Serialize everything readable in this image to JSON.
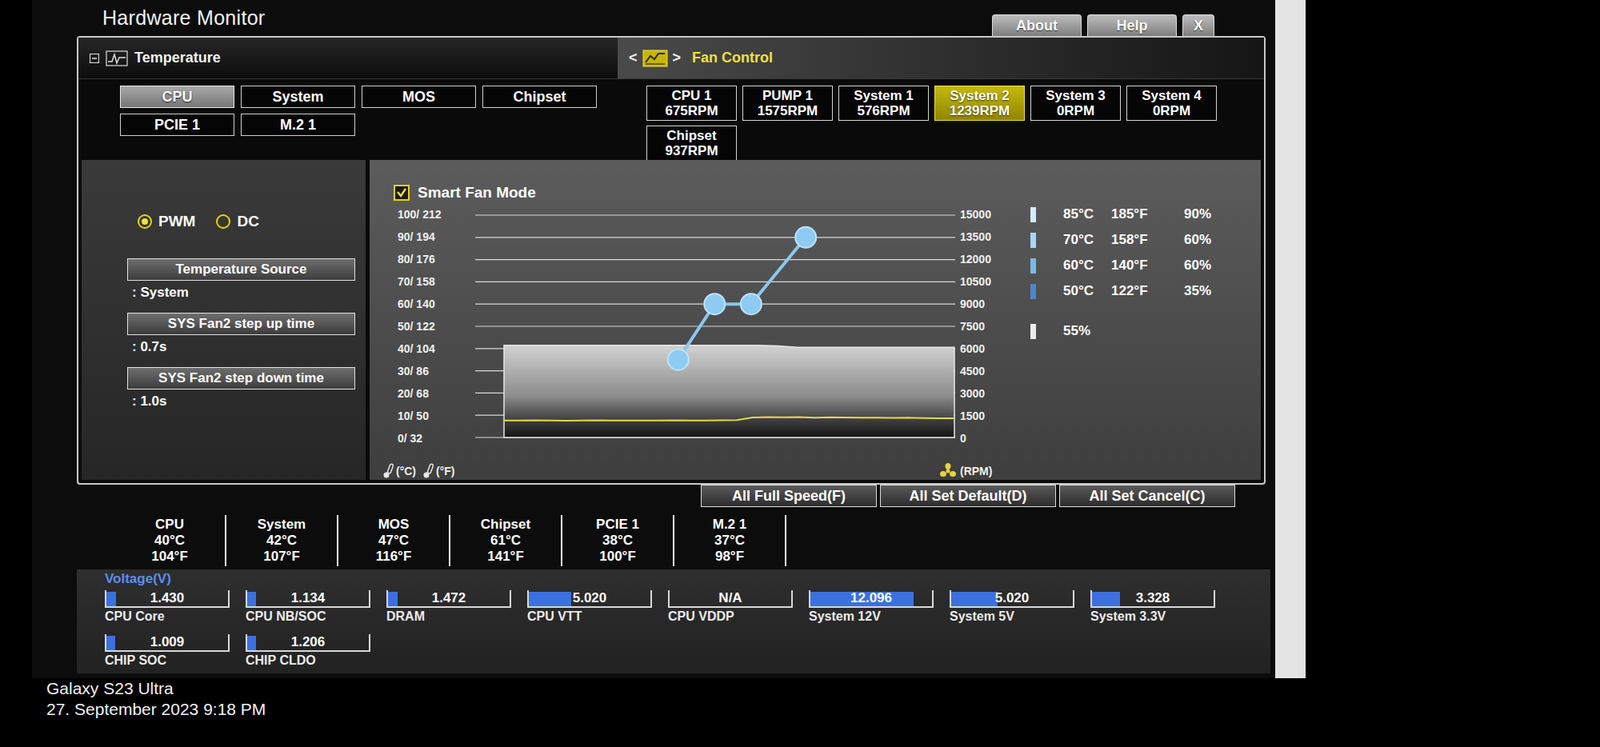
{
  "window": {
    "title": "Hardware Monitor"
  },
  "title_buttons": [
    "About",
    "Help",
    "X"
  ],
  "temperature_header": {
    "title": "Temperature"
  },
  "fan_control_header": {
    "title": "Fan Control",
    "prev": "<",
    "next": ">"
  },
  "temperature_sources": [
    {
      "label": "CPU",
      "selected": true
    },
    {
      "label": "System",
      "selected": false
    },
    {
      "label": "MOS",
      "selected": false
    },
    {
      "label": "Chipset",
      "selected": false
    },
    {
      "label": "PCIE 1",
      "selected": false
    },
    {
      "label": "M.2 1",
      "selected": false
    }
  ],
  "fans": [
    {
      "name": "CPU 1",
      "rpm": "675RPM",
      "selected": false
    },
    {
      "name": "PUMP 1",
      "rpm": "1575RPM",
      "selected": false
    },
    {
      "name": "System 1",
      "rpm": "576RPM",
      "selected": false
    },
    {
      "name": "System 2",
      "rpm": "1239RPM",
      "selected": true
    },
    {
      "name": "System 3",
      "rpm": "0RPM",
      "selected": false
    },
    {
      "name": "System 4",
      "rpm": "0RPM",
      "selected": false
    },
    {
      "name": "Chipset",
      "rpm": "937RPM",
      "selected": false
    }
  ],
  "fan_mode": [
    {
      "label": "PWM",
      "selected": true
    },
    {
      "label": "DC",
      "selected": false
    }
  ],
  "settings": [
    {
      "label": "Temperature Source",
      "value": ": System"
    },
    {
      "label": "SYS Fan2 step up time",
      "value": ": 0.7s"
    },
    {
      "label": "SYS Fan2 step down time",
      "value": ": 1.0s"
    }
  ],
  "smart_fan_mode": {
    "label": "Smart Fan Mode",
    "checked": true
  },
  "chart": {
    "left_ticks": [
      "100/ 212",
      "90/ 194",
      "80/ 176",
      "70/ 158",
      "60/ 140",
      "50/ 122",
      "40/ 104",
      "30/ 86",
      "20/ 68",
      "10/ 50",
      "0/ 32"
    ],
    "right_ticks": [
      "15000",
      "13500",
      "12000",
      "10500",
      "9000",
      "7500",
      "6000",
      "4500",
      "3000",
      "1500",
      "0"
    ],
    "left_units": [
      "(°C)",
      "(°F)"
    ],
    "right_unit": "(RPM)",
    "curve": [
      {
        "temp": 50,
        "duty": 35
      },
      {
        "temp": 60,
        "duty": 60
      },
      {
        "temp": 70,
        "duty": 60
      },
      {
        "temp": 85,
        "duty": 90
      }
    ],
    "temperature_history": [
      41.5,
      41.5,
      41.5,
      41.5,
      41.5,
      41.5,
      41.5,
      41.5,
      41.5,
      41.5,
      41.5,
      41.5,
      41.5,
      41.5,
      41.2,
      40.6,
      40.6,
      40.6,
      40.6,
      40.6,
      40.6,
      40.6,
      40.6,
      40.6
    ],
    "rpm_history": [
      1150,
      1140,
      1160,
      1150,
      1130,
      1150,
      1160,
      1140,
      1150,
      1150,
      1140,
      1160,
      1150,
      1140,
      1160,
      1170,
      1350,
      1380,
      1360,
      1370,
      1340,
      1360,
      1350,
      1330,
      1340,
      1320,
      1330,
      1310,
      1300,
      1290
    ]
  },
  "curve_legend": [
    {
      "celsius": "85°C",
      "fahrenheit": "185°F",
      "duty": "90%",
      "color": "#d5ecff"
    },
    {
      "celsius": "70°C",
      "fahrenheit": "158°F",
      "duty": "60%",
      "color": "#a9d6f7"
    },
    {
      "celsius": "60°C",
      "fahrenheit": "140°F",
      "duty": "60%",
      "color": "#79b7ec"
    },
    {
      "celsius": "50°C",
      "fahrenheit": "122°F",
      "duty": "35%",
      "color": "#4a86d6"
    }
  ],
  "current_duty": "55%",
  "actions": [
    "All Full Speed(F)",
    "All Set Default(D)",
    "All Set Cancel(C)"
  ],
  "temperatures": [
    {
      "name": "CPU",
      "celsius": "40°C",
      "fahrenheit": "104°F"
    },
    {
      "name": "System",
      "celsius": "42°C",
      "fahrenheit": "107°F"
    },
    {
      "name": "MOS",
      "celsius": "47°C",
      "fahrenheit": "116°F"
    },
    {
      "name": "Chipset",
      "celsius": "61°C",
      "fahrenheit": "141°F"
    },
    {
      "name": "PCIE 1",
      "celsius": "38°C",
      "fahrenheit": "100°F"
    },
    {
      "name": "M.2 1",
      "celsius": "37°C",
      "fahrenheit": "98°F"
    }
  ],
  "voltage": {
    "title": "Voltage(V)",
    "rows": [
      [
        {
          "name": "CPU Core",
          "value": "1.430",
          "level": 0.08
        },
        {
          "name": "CPU NB/SOC",
          "value": "1.134",
          "level": 0.07
        },
        {
          "name": "DRAM",
          "value": "1.472",
          "level": 0.08
        },
        {
          "name": "CPU VTT",
          "value": "5.020",
          "level": 0.35
        },
        {
          "name": "CPU VDDP",
          "value": "N/A",
          "level": 0
        },
        {
          "name": "System 12V",
          "value": "12.096",
          "level": 0.85
        },
        {
          "name": "System 5V",
          "value": "5.020",
          "level": 0.38
        },
        {
          "name": "System 3.3V",
          "value": "3.328",
          "level": 0.23
        }
      ],
      [
        {
          "name": "CHIP SOC",
          "value": "1.009",
          "level": 0.07
        },
        {
          "name": "CHIP CLDO",
          "value": "1.206",
          "level": 0.07
        }
      ]
    ]
  },
  "watermark": [
    "Galaxy S23 Ultra",
    "27. September 2023 9:18 PM"
  ]
}
